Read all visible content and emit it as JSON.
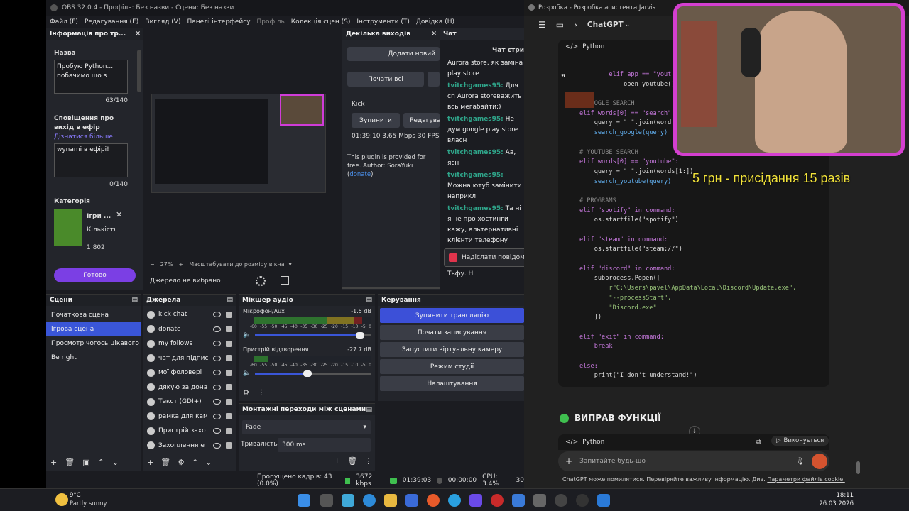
{
  "obs": {
    "title": "OBS 32.0.4 - Профіль: Без назви - Сцени: Без назви",
    "menu": [
      "Файл (F)",
      "Редагування (E)",
      "Вигляд (V)",
      "Панелі інтерфейсу",
      "Профіль",
      "Колекція сцен (S)",
      "Інструменти (T)",
      "Довідка (H)"
    ],
    "info_panel": {
      "title": "Інформація про тр...",
      "name_label": "Назва",
      "name_value": "Пробую Python... побачимо що з",
      "name_count": "63/140",
      "notify_label": "Сповіщення про вихід в ефір",
      "notify_link": "Дізнатися більше",
      "notify_value": "wynami в ефірі!",
      "notify_count": "0/140",
      "category_label": "Категорія",
      "category_name": "Ігри ...",
      "viewers_label": "Кількість глядачі",
      "viewers_count": "1 802",
      "done_button": "Готово"
    },
    "preview": {
      "zoom": "27%",
      "fit_label": "Масштабувати до розміру вікна",
      "no_source": "Джерело не вибрано"
    },
    "multi_output": {
      "title": "Декілька виходів",
      "add_new": "Додати новий",
      "start_all": "Почати всі",
      "service": "Kick",
      "stop": "Зупинити",
      "edit": "Редагувати",
      "stats": "01:39:10  3.65 Mbps  30 FPS",
      "plugin_note": "This plugin is provided for free. Author: SoraYuki (",
      "plugin_link": "donate",
      "plugin_close": ")"
    },
    "chat": {
      "title": "Чат",
      "header": "Чат стрима",
      "messages": [
        {
          "user": "",
          "text": "Aurora store, як заміна play store"
        },
        {
          "user": "tvitchgames95:",
          "text": " Для сп Aurora storeважить всь мегабайти:)"
        },
        {
          "user": "tvitchgames95:",
          "text": " Не дум google play store власн"
        },
        {
          "user": "tvitchgames95:",
          "text": " Аа, ясн"
        },
        {
          "user": "tvitchgames95:",
          "text": " Можна ютуб замінити наприкл"
        },
        {
          "user": "tvitchgames95:",
          "text": " Та ні я не про хостинги кажу, альтернативні клієнти телефону наприклад"
        },
        {
          "user": "tvitchgames95:",
          "text": " Тьфу. Н"
        }
      ],
      "send_placeholder": "Надіслати повідом"
    },
    "scenes": {
      "title": "Сцени",
      "items": [
        "Початкова сцена",
        "Ігрова сцена",
        "Просмотр чогось цікавого",
        "Be right"
      ],
      "selected": 1
    },
    "sources": {
      "title": "Джерела",
      "items": [
        "kick chat",
        "donate",
        "my follows",
        "чат для підпис",
        "мої фоловері",
        "дякую за дона",
        "Текст (GDI+)",
        "рамка для кам",
        "Пристрій захо",
        "Захоплення е"
      ]
    },
    "mixer": {
      "title": "Мікшер аудіо",
      "channels": [
        {
          "name": "Мікрофон/Aux",
          "db": "-1.5 dB",
          "level": 0.92,
          "volume": 0.9
        },
        {
          "name": "Пристрій відтворення",
          "db": "-27.7 dB",
          "level": 0.12,
          "volume": 0.45
        }
      ],
      "scale": [
        "-60",
        "-55",
        "-50",
        "-45",
        "-40",
        "-35",
        "-30",
        "-25",
        "-20",
        "-15",
        "-10",
        "-5",
        "0"
      ]
    },
    "transitions": {
      "title": "Монтажні переходи між сценами",
      "type": "Fade",
      "duration_label": "Тривалість",
      "duration_value": "300 ms"
    },
    "controls": {
      "title": "Керування",
      "buttons": [
        "Зупинити трансляцію",
        "Почати записування",
        "Запустити віртуальну камеру",
        "Режим студії",
        "Налаштування"
      ]
    },
    "status": {
      "dropped": "Пропущено кадрів: 43 (0.0%)",
      "bitrate": "3672 kbps",
      "stream_time": "01:39:03",
      "rec_time": "00:00:00",
      "cpu": "CPU: 3.4%",
      "fps": "30"
    }
  },
  "gpt": {
    "window_title": "Розробка - Розробка асистента Jarvis",
    "breadcrumb": "ChatGPT",
    "code_lang": "Python",
    "code_lines": [
      {
        "t": "        elif app == \"yout",
        "c": "kw"
      },
      {
        "t": "            open_youtube()",
        "c": ""
      },
      {
        "t": "",
        "c": ""
      },
      {
        "t": "# GOOGLE SEARCH",
        "c": "cm"
      },
      {
        "t": "elif words[0] == \"search\"",
        "c": "kw"
      },
      {
        "t": "    query = \" \".join(word",
        "c": ""
      },
      {
        "t": "    search_google(query)",
        "c": "fn"
      },
      {
        "t": "",
        "c": ""
      },
      {
        "t": "# YOUTUBE SEARCH",
        "c": "cm"
      },
      {
        "t": "elif words[0] == \"youtube\":",
        "c": "kw"
      },
      {
        "t": "    query = \" \".join(words[1:])",
        "c": ""
      },
      {
        "t": "    search_youtube(query)",
        "c": "fn"
      },
      {
        "t": "",
        "c": ""
      },
      {
        "t": "# PROGRAMS",
        "c": "cm"
      },
      {
        "t": "elif \"spotify\" in command:",
        "c": "kw"
      },
      {
        "t": "    os.startfile(\"spotify\")",
        "c": ""
      },
      {
        "t": "",
        "c": ""
      },
      {
        "t": "elif \"steam\" in command:",
        "c": "kw"
      },
      {
        "t": "    os.startfile(\"steam://\")",
        "c": ""
      },
      {
        "t": "",
        "c": ""
      },
      {
        "t": "elif \"discord\" in command:",
        "c": "kw"
      },
      {
        "t": "    subprocess.Popen([",
        "c": ""
      },
      {
        "t": "        r\"C:\\Users\\pavel\\AppData\\Local\\Discord\\Update.exe\",",
        "c": "st"
      },
      {
        "t": "        \"--processStart\",",
        "c": "st"
      },
      {
        "t": "        \"Discord.exe\"",
        "c": "st"
      },
      {
        "t": "    ])",
        "c": ""
      },
      {
        "t": "",
        "c": ""
      },
      {
        "t": "elif \"exit\" in command:",
        "c": "kw"
      },
      {
        "t": "    break",
        "c": "kw"
      },
      {
        "t": "",
        "c": ""
      },
      {
        "t": "else:",
        "c": "kw"
      },
      {
        "t": "    print(\"I don't understand!\")",
        "c": ""
      }
    ],
    "section_title": "ВИПРАВ ФУНКЦІЇ",
    "code_lang2": "Python",
    "running": "Виконується",
    "input_placeholder": "Запитайте будь-що",
    "disclaimer": "ChatGPT може помилятися. Перевіряйте важливу інформацію. Див.",
    "disclaimer_link": "Параметри файлів cookie."
  },
  "overlay": {
    "donation_text": "5 грн - присідання 15 разів"
  },
  "taskbar": {
    "weather_temp": "9°C",
    "weather_desc": "Partly sunny",
    "time": "18:11",
    "date": "26.03.2026"
  }
}
